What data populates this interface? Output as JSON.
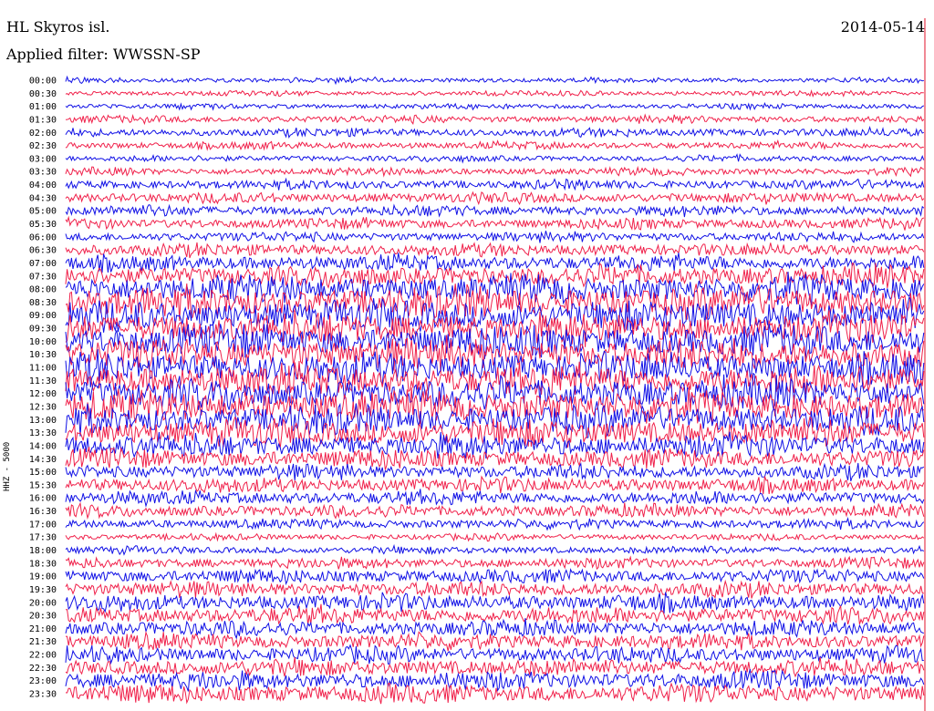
{
  "header": {
    "station": "HL Skyros isl.",
    "filter": "Applied filter: WWSSN-SP",
    "date": "2014-05-14"
  },
  "channel_label": "HHZ - 5000",
  "colors": {
    "trace_a": "#1010e6",
    "trace_b": "#f0204a",
    "marker": "#e0102a"
  },
  "chart_data": {
    "type": "line",
    "title": "HL Skyros isl.",
    "subtitle": "Applied filter: WWSSN-SP",
    "date": "2014-05-14",
    "ylabel": "HHZ - 5000",
    "row_interval_minutes": 30,
    "rows": [
      "00:00",
      "00:30",
      "01:00",
      "01:30",
      "02:00",
      "02:30",
      "03:00",
      "03:30",
      "04:00",
      "04:30",
      "05:00",
      "05:30",
      "06:00",
      "06:30",
      "07:00",
      "07:30",
      "08:00",
      "08:30",
      "09:00",
      "09:30",
      "10:00",
      "10:30",
      "11:00",
      "11:30",
      "12:00",
      "12:30",
      "13:00",
      "13:30",
      "14:00",
      "14:30",
      "15:00",
      "15:30",
      "16:00",
      "16:30",
      "17:00",
      "17:30",
      "18:00",
      "18:30",
      "19:00",
      "19:30",
      "20:00",
      "20:30",
      "21:00",
      "21:30",
      "22:00",
      "22:30",
      "23:00",
      "23:30"
    ],
    "series": [
      {
        "color": "#1010e6"
      },
      {
        "color": "#f0204a"
      }
    ],
    "relative_amplitude": [
      0.5,
      0.5,
      0.5,
      0.7,
      0.8,
      0.7,
      0.6,
      0.7,
      0.9,
      1.0,
      1.0,
      1.0,
      0.9,
      1.2,
      1.5,
      2.0,
      2.6,
      3.0,
      3.0,
      3.0,
      3.0,
      3.0,
      3.0,
      3.0,
      3.0,
      3.0,
      2.8,
      2.6,
      2.2,
      1.8,
      1.4,
      1.4,
      1.3,
      1.2,
      0.9,
      0.6,
      0.7,
      1.0,
      1.3,
      1.4,
      1.6,
      1.6,
      1.5,
      1.5,
      1.5,
      1.6,
      1.7,
      1.8
    ],
    "grid": false,
    "legend": "none"
  }
}
